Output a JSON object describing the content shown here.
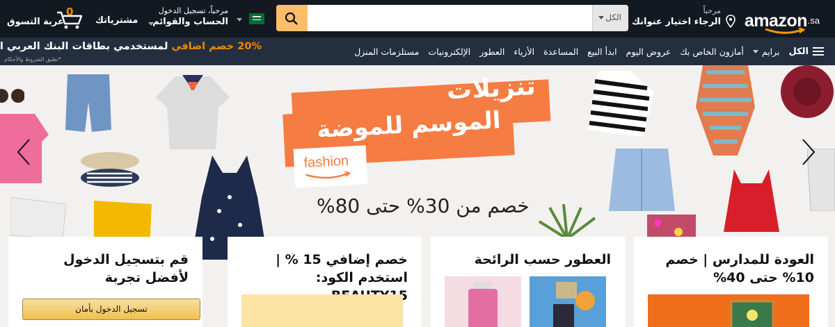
{
  "header": {
    "logo_text": "amazon",
    "logo_suffix": ".sa",
    "deliver_greeting": "مرحباً",
    "deliver_prompt": "الرجاء اختيار عنوانك",
    "search_category": "الكل",
    "search_placeholder": "",
    "account_greeting": "مرحباً، تسجيل الدخول",
    "account_label": "الحساب والقوائم",
    "orders_label": "مشترياتك",
    "cart_count": "0",
    "cart_label": "عربة التسوق"
  },
  "subnav": {
    "items": [
      {
        "label": "الكل",
        "icon": "hamburger-icon"
      },
      {
        "label": "برايم"
      },
      {
        "label": "أمازون الخاص بك"
      },
      {
        "label": "عروض اليوم"
      },
      {
        "label": "ابدأ البيع"
      },
      {
        "label": "المساعدة"
      },
      {
        "label": "الأزياء"
      },
      {
        "label": "العطور"
      },
      {
        "label": "الإلكترونيات"
      },
      {
        "label": "مستلزمات المنزل"
      }
    ],
    "promo_prefix": "خصم اضافي",
    "promo_percent": "20%",
    "promo_main": "لمستخدمي بطاقات البنك العربي الوطني",
    "promo_note": "*تطبق الشروط والأحكام"
  },
  "hero": {
    "line1": "تنزيلات",
    "line2": "الموسم للموضة",
    "brand": "fashion",
    "discount": "خصم من 30% حتى 80%"
  },
  "cards": [
    {
      "title": "قم بتسجيل الدخول لأفضل تجربة",
      "button": "تسجيل الدخول بأمان"
    },
    {
      "title": "خصم إضافي 15 % | استخدم الكود: BEAUTY15"
    },
    {
      "title": "العطور حسب الرائحة"
    },
    {
      "title": "العودة للمدارس | خصم 10% حتى 40%"
    }
  ],
  "colors": {
    "nav_bg": "#131921",
    "subnav_bg": "#232f3e",
    "search_button": "#febd69",
    "accent_orange": "#f08804",
    "banner_orange": "#f57c42"
  }
}
